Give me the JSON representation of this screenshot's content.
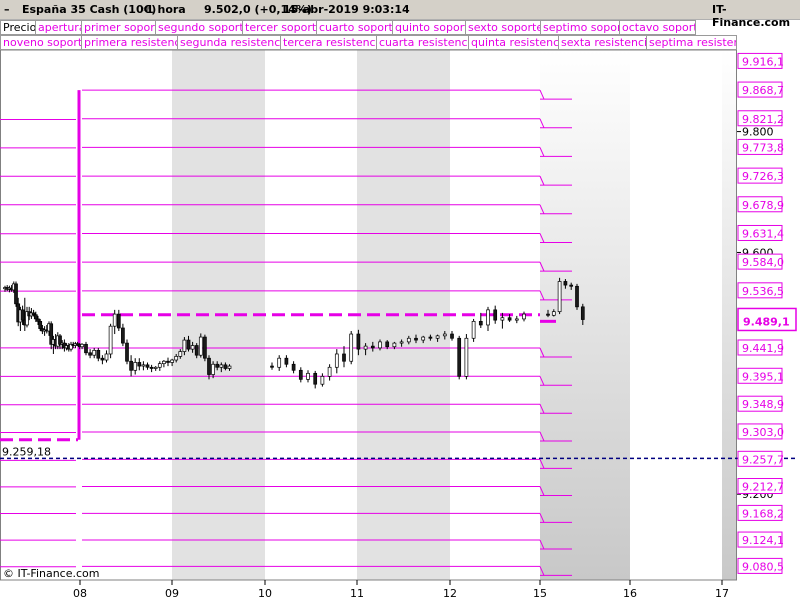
{
  "header": {
    "instrument": "España 35 Cash (10€)",
    "timeframe": "1 hora",
    "quote": "9.502,0 (+0,14%)",
    "datetime": "15-abr-2019 9:03:14",
    "brand": "IT-Finance.com"
  },
  "legend": {
    "row1": [
      "Precio",
      "apertura",
      "primer soporte",
      "segundo soporte",
      "tercer soporte",
      "cuarto soporte",
      "quinto soporte",
      "sexto soporte",
      "septimo soporte",
      "octavo soporte"
    ],
    "row2": [
      "noveno soporte",
      "primera resistencia",
      "segunda resistencia",
      "tercera resistencia",
      "cuarta resistencia",
      "quinta resistencia",
      "sexta resistencia",
      "septima resistencia"
    ]
  },
  "watermark": "© IT-Finance.com",
  "chart_data": {
    "type": "candlestick",
    "colors": {
      "level": "#e600e6",
      "reference": "#000080",
      "bull": "#ffffff",
      "bear": "#1a1a1a",
      "price_tag": "#e600e6"
    },
    "x_ticks": [
      "08",
      "09",
      "10",
      "11",
      "12",
      "15",
      "16",
      "17"
    ],
    "y_ticks_black": [
      "9.800",
      "9.600",
      "9.200"
    ],
    "level_labels": [
      "9.916,1",
      "9.868,7",
      "9.821,2",
      "9.773,8",
      "9.726,3",
      "9.678,9",
      "9.631,4",
      "9.584,0",
      "9.536,5",
      "9.441,9",
      "9.395,1",
      "9.348,9",
      "9.303,0",
      "9.257,7",
      "9.212,7",
      "9.168,2",
      "9.124,1",
      "9.080,5"
    ],
    "current_price": "9.489,1",
    "reference_label": "9.259,18",
    "reference_value": 9259.18,
    "levels_left": [
      9820,
      9773,
      9726,
      9679,
      9631,
      9584,
      9536,
      9442,
      9395,
      9348,
      9302,
      9256,
      9212,
      9168,
      9124,
      9080
    ],
    "levels_main": [
      9868.7,
      9821.2,
      9773.8,
      9726.3,
      9678.9,
      9631.4,
      9584.0,
      9536.5,
      9441.9,
      9395.1,
      9348.9,
      9303.0,
      9257.7,
      9212.7,
      9168.2,
      9124.1,
      9080.5
    ],
    "levels_right": [
      9868.7,
      9821.2,
      9773.8,
      9726.3,
      9678.9,
      9631.4,
      9584.0,
      9536.5,
      9441.9,
      9395.1,
      9348.9,
      9303.0,
      9257.7,
      9212.7,
      9168.2,
      9124.1,
      9080.5
    ],
    "open_prev": 9290,
    "open_week": 9497,
    "open_day": 9486,
    "ylim": [
      9058,
      9935
    ],
    "candles": [
      {
        "o": 9540,
        "h": 9545,
        "l": 9535,
        "c": 9542
      },
      {
        "o": 9542,
        "h": 9546,
        "l": 9536,
        "c": 9539
      },
      {
        "o": 9539,
        "h": 9545,
        "l": 9534,
        "c": 9541
      },
      {
        "o": 9541,
        "h": 9546,
        "l": 9535,
        "c": 9538
      },
      {
        "o": 9538,
        "h": 9552,
        "l": 9533,
        "c": 9548
      },
      {
        "o": 9548,
        "h": 9552,
        "l": 9510,
        "c": 9515
      },
      {
        "o": 9515,
        "h": 9525,
        "l": 9478,
        "c": 9485
      },
      {
        "o": 9485,
        "h": 9510,
        "l": 9470,
        "c": 9505
      },
      {
        "o": 9505,
        "h": 9512,
        "l": 9480,
        "c": 9488
      },
      {
        "o": 9488,
        "h": 9525,
        "l": 9470,
        "c": 9480
      },
      {
        "o": 9480,
        "h": 9510,
        "l": 9476,
        "c": 9502
      },
      {
        "o": 9502,
        "h": 9510,
        "l": 9488,
        "c": 9495
      },
      {
        "o": 9495,
        "h": 9508,
        "l": 9490,
        "c": 9500
      },
      {
        "o": 9500,
        "h": 9505,
        "l": 9494,
        "c": 9497
      },
      {
        "o": 9497,
        "h": 9502,
        "l": 9485,
        "c": 9490
      },
      {
        "o": 9490,
        "h": 9495,
        "l": 9480,
        "c": 9486
      },
      {
        "o": 9486,
        "h": 9490,
        "l": 9470,
        "c": 9474
      },
      {
        "o": 9474,
        "h": 9480,
        "l": 9465,
        "c": 9470
      },
      {
        "o": 9470,
        "h": 9478,
        "l": 9462,
        "c": 9472
      },
      {
        "o": 9472,
        "h": 9480,
        "l": 9466,
        "c": 9470
      },
      {
        "o": 9470,
        "h": 9486,
        "l": 9462,
        "c": 9482
      },
      {
        "o": 9482,
        "h": 9486,
        "l": 9440,
        "c": 9448
      },
      {
        "o": 9448,
        "h": 9462,
        "l": 9432,
        "c": 9456
      },
      {
        "o": 9456,
        "h": 9465,
        "l": 9440,
        "c": 9445
      },
      {
        "o": 9445,
        "h": 9468,
        "l": 9440,
        "c": 9462
      },
      {
        "o": 9462,
        "h": 9465,
        "l": 9440,
        "c": 9448
      },
      {
        "o": 9448,
        "h": 9455,
        "l": 9440,
        "c": 9450
      },
      {
        "o": 9450,
        "h": 9456,
        "l": 9436,
        "c": 9442
      },
      {
        "o": 9442,
        "h": 9450,
        "l": 9438,
        "c": 9446
      },
      {
        "o": 9446,
        "h": 9450,
        "l": 9436,
        "c": 9440
      },
      {
        "o": 9440,
        "h": 9452,
        "l": 9436,
        "c": 9448
      },
      {
        "o": 9448,
        "h": 9452,
        "l": 9442,
        "c": 9446
      },
      {
        "o": 9446,
        "h": 9452,
        "l": 9442,
        "c": 9449
      },
      {
        "o": 9449,
        "h": 9452,
        "l": 9445,
        "c": 9447
      },
      {
        "o": 9447,
        "h": 9450,
        "l": 9440,
        "c": 9444
      },
      {
        "o": 9444,
        "h": 9450,
        "l": 9440,
        "c": 9448
      },
      {
        "o": 9448,
        "h": 9452,
        "l": 9430,
        "c": 9434
      },
      {
        "o": 9434,
        "h": 9440,
        "l": 9425,
        "c": 9430
      },
      {
        "o": 9430,
        "h": 9442,
        "l": 9425,
        "c": 9438
      },
      {
        "o": 9438,
        "h": 9442,
        "l": 9420,
        "c": 9425
      },
      {
        "o": 9425,
        "h": 9430,
        "l": 9415,
        "c": 9422
      },
      {
        "o": 9422,
        "h": 9438,
        "l": 9418,
        "c": 9432
      },
      {
        "o": 9432,
        "h": 9482,
        "l": 9425,
        "c": 9478
      },
      {
        "o": 9478,
        "h": 9505,
        "l": 9465,
        "c": 9498
      },
      {
        "o": 9498,
        "h": 9505,
        "l": 9470,
        "c": 9475
      },
      {
        "o": 9475,
        "h": 9482,
        "l": 9445,
        "c": 9450
      },
      {
        "o": 9450,
        "h": 9456,
        "l": 9415,
        "c": 9420
      },
      {
        "o": 9420,
        "h": 9430,
        "l": 9395,
        "c": 9405
      },
      {
        "o": 9405,
        "h": 9425,
        "l": 9398,
        "c": 9418
      },
      {
        "o": 9418,
        "h": 9425,
        "l": 9405,
        "c": 9412
      },
      {
        "o": 9412,
        "h": 9420,
        "l": 9405,
        "c": 9414
      },
      {
        "o": 9414,
        "h": 9418,
        "l": 9406,
        "c": 9410
      },
      {
        "o": 9410,
        "h": 9414,
        "l": 9402,
        "c": 9408
      },
      {
        "o": 9408,
        "h": 9412,
        "l": 9404,
        "c": 9410
      },
      {
        "o": 9410,
        "h": 9420,
        "l": 9404,
        "c": 9416
      },
      {
        "o": 9416,
        "h": 9422,
        "l": 9410,
        "c": 9420
      },
      {
        "o": 9420,
        "h": 9426,
        "l": 9412,
        "c": 9418
      },
      {
        "o": 9418,
        "h": 9424,
        "l": 9412,
        "c": 9422
      },
      {
        "o": 9422,
        "h": 9432,
        "l": 9418,
        "c": 9428
      },
      {
        "o": 9428,
        "h": 9440,
        "l": 9424,
        "c": 9436
      },
      {
        "o": 9436,
        "h": 9460,
        "l": 9430,
        "c": 9455
      },
      {
        "o": 9455,
        "h": 9462,
        "l": 9436,
        "c": 9440
      },
      {
        "o": 9440,
        "h": 9452,
        "l": 9434,
        "c": 9446
      },
      {
        "o": 9446,
        "h": 9450,
        "l": 9425,
        "c": 9430
      },
      {
        "o": 9430,
        "h": 9466,
        "l": 9426,
        "c": 9460
      },
      {
        "o": 9460,
        "h": 9464,
        "l": 9420,
        "c": 9425
      },
      {
        "o": 9425,
        "h": 9430,
        "l": 9390,
        "c": 9398
      },
      {
        "o": 9398,
        "h": 9420,
        "l": 9392,
        "c": 9415
      },
      {
        "o": 9415,
        "h": 9420,
        "l": 9405,
        "c": 9410
      },
      {
        "o": 9410,
        "h": 9418,
        "l": 9402,
        "c": 9414
      },
      {
        "o": 9414,
        "h": 9418,
        "l": 9405,
        "c": 9408
      },
      {
        "o": 9408,
        "h": 9415,
        "l": 9404,
        "c": 9412
      },
      {
        "o": 9412,
        "h": 9418,
        "l": 9406,
        "c": 9410
      },
      {
        "o": 9410,
        "h": 9430,
        "l": 9404,
        "c": 9425
      },
      {
        "o": 9425,
        "h": 9430,
        "l": 9410,
        "c": 9415
      },
      {
        "o": 9415,
        "h": 9420,
        "l": 9400,
        "c": 9405
      },
      {
        "o": 9405,
        "h": 9410,
        "l": 9385,
        "c": 9390
      },
      {
        "o": 9390,
        "h": 9405,
        "l": 9385,
        "c": 9400
      },
      {
        "o": 9400,
        "h": 9404,
        "l": 9375,
        "c": 9382
      },
      {
        "o": 9382,
        "h": 9400,
        "l": 9378,
        "c": 9395
      },
      {
        "o": 9395,
        "h": 9415,
        "l": 9388,
        "c": 9410
      },
      {
        "o": 9410,
        "h": 9440,
        "l": 9400,
        "c": 9432
      },
      {
        "o": 9432,
        "h": 9445,
        "l": 9410,
        "c": 9420
      },
      {
        "o": 9420,
        "h": 9470,
        "l": 9415,
        "c": 9465
      },
      {
        "o": 9465,
        "h": 9472,
        "l": 9430,
        "c": 9440
      },
      {
        "o": 9440,
        "h": 9450,
        "l": 9430,
        "c": 9445
      },
      {
        "o": 9445,
        "h": 9452,
        "l": 9436,
        "c": 9442
      },
      {
        "o": 9442,
        "h": 9456,
        "l": 9438,
        "c": 9452
      },
      {
        "o": 9452,
        "h": 9455,
        "l": 9440,
        "c": 9444
      },
      {
        "o": 9444,
        "h": 9452,
        "l": 9440,
        "c": 9450
      },
      {
        "o": 9450,
        "h": 9456,
        "l": 9444,
        "c": 9452
      },
      {
        "o": 9452,
        "h": 9462,
        "l": 9448,
        "c": 9458
      },
      {
        "o": 9458,
        "h": 9464,
        "l": 9450,
        "c": 9455
      },
      {
        "o": 9455,
        "h": 9462,
        "l": 9450,
        "c": 9460
      },
      {
        "o": 9460,
        "h": 9464,
        "l": 9454,
        "c": 9458
      },
      {
        "o": 9458,
        "h": 9464,
        "l": 9452,
        "c": 9462
      },
      {
        "o": 9462,
        "h": 9470,
        "l": 9456,
        "c": 9465
      },
      {
        "o": 9465,
        "h": 9470,
        "l": 9454,
        "c": 9458
      },
      {
        "o": 9458,
        "h": 9462,
        "l": 9390,
        "c": 9395
      },
      {
        "o": 9395,
        "h": 9465,
        "l": 9390,
        "c": 9458
      },
      {
        "o": 9458,
        "h": 9490,
        "l": 9452,
        "c": 9486
      },
      {
        "o": 9486,
        "h": 9500,
        "l": 9475,
        "c": 9480
      },
      {
        "o": 9480,
        "h": 9510,
        "l": 9470,
        "c": 9505
      },
      {
        "o": 9505,
        "h": 9512,
        "l": 9482,
        "c": 9488
      },
      {
        "o": 9488,
        "h": 9500,
        "l": 9474,
        "c": 9492
      },
      {
        "o": 9492,
        "h": 9498,
        "l": 9485,
        "c": 9488
      },
      {
        "o": 9488,
        "h": 9495,
        "l": 9483,
        "c": 9490
      },
      {
        "o": 9490,
        "h": 9502,
        "l": 9486,
        "c": 9498
      },
      {
        "o": 9498,
        "h": 9505,
        "l": 9493,
        "c": 9496
      },
      {
        "o": 9496,
        "h": 9506,
        "l": 9494,
        "c": 9502
      },
      {
        "o": 9502,
        "h": 9558,
        "l": 9498,
        "c": 9552
      },
      {
        "o": 9552,
        "h": 9556,
        "l": 9540,
        "c": 9546
      },
      {
        "o": 9546,
        "h": 9550,
        "l": 9538,
        "c": 9544
      },
      {
        "o": 9544,
        "h": 9548,
        "l": 9505,
        "c": 9510
      },
      {
        "o": 9510,
        "h": 9515,
        "l": 9480,
        "c": 9489
      }
    ]
  }
}
